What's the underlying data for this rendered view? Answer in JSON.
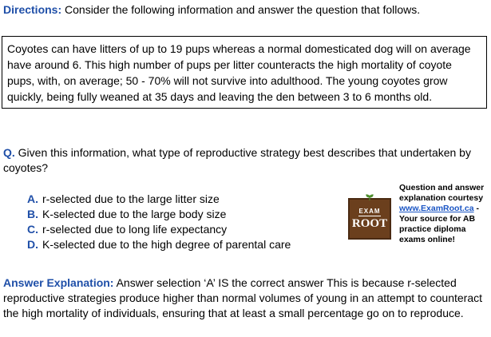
{
  "directions": {
    "label": "Directions:",
    "text": " Consider the following information and answer the question that follows."
  },
  "passage": "Coyotes can have litters of up to 19 pups whereas a normal domesticated dog will on average have around 6. This high number of pups per litter counteracts the high mortality of coyote pups, with, on average; 50 - 70% will not survive into adulthood. The young coyotes grow quickly, being fully weaned at 35 days and leaving the den between 3 to 6 months old.",
  "question": {
    "label": "Q.",
    "text": "  Given this information, what type of reproductive strategy best describes that undertaken by coyotes?"
  },
  "options": [
    {
      "letter": "A.",
      "text": "r-selected due to the large litter size"
    },
    {
      "letter": "B.",
      "text": "K-selected due to the large body size"
    },
    {
      "letter": "C.",
      "text": "r-selected due to long life expectancy"
    },
    {
      "letter": "D.",
      "text": "K-selected due to the high degree of parental care"
    }
  ],
  "logo": {
    "top_text": "EXAM",
    "main_text": "ROOT"
  },
  "credit": {
    "line1": "Question and answer explanation courtesy ",
    "link": "www.ExamRoot.ca",
    "line2": " - Your source for AB practice diploma exams online!"
  },
  "explanation": {
    "label": "Answer Explanation:",
    "text": " Answer selection ‘A’ IS the correct answer This is because r-selected reproductive strategies produce higher than normal volumes of young in an attempt to counteract the high mortality of individuals, ensuring that at least a small percentage go on to reproduce."
  },
  "colors": {
    "heading_blue": "#1f4fa8",
    "link_blue": "#1a55c4",
    "logo_brown": "#6b3f1d"
  }
}
